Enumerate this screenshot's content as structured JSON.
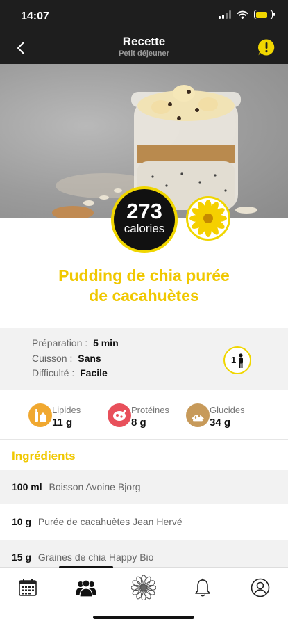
{
  "status": {
    "time": "14:07"
  },
  "header": {
    "title": "Recette",
    "subtitle": "Petit déjeuner"
  },
  "calories": {
    "value": "273",
    "label": "calories"
  },
  "recipe": {
    "title_line1": "Pudding de chia purée",
    "title_line2": "de cacahuètes"
  },
  "details": {
    "preparation_label": "Préparation :",
    "preparation_value": "5 min",
    "cuisson_label": "Cuisson :",
    "cuisson_value": "Sans",
    "difficulte_label": "Difficulté :",
    "difficulte_value": "Facile",
    "persons": "1"
  },
  "macros": [
    {
      "name": "Lipides",
      "value": "11 g",
      "color": "#f0a830"
    },
    {
      "name": "Protéines",
      "value": "8 g",
      "color": "#e8505b"
    },
    {
      "name": "Glucides",
      "value": "34 g",
      "color": "#c79a5a"
    }
  ],
  "ingredients": {
    "title": "Ingrédients",
    "items": [
      {
        "qty": "100 ml",
        "name": "Boisson Avoine Bjorg"
      },
      {
        "qty": "10 g",
        "name": "Purée de cacahuètes Jean Hervé"
      },
      {
        "qty": "15 g",
        "name": "Graines de chia Happy Bio"
      }
    ]
  },
  "tabs": [
    {
      "icon": "calendar-icon"
    },
    {
      "icon": "community-icon"
    },
    {
      "icon": "flower-icon"
    },
    {
      "icon": "bell-icon"
    },
    {
      "icon": "profile-icon"
    }
  ],
  "colors": {
    "accent": "#f0c800",
    "dark": "#1e1e1e"
  }
}
